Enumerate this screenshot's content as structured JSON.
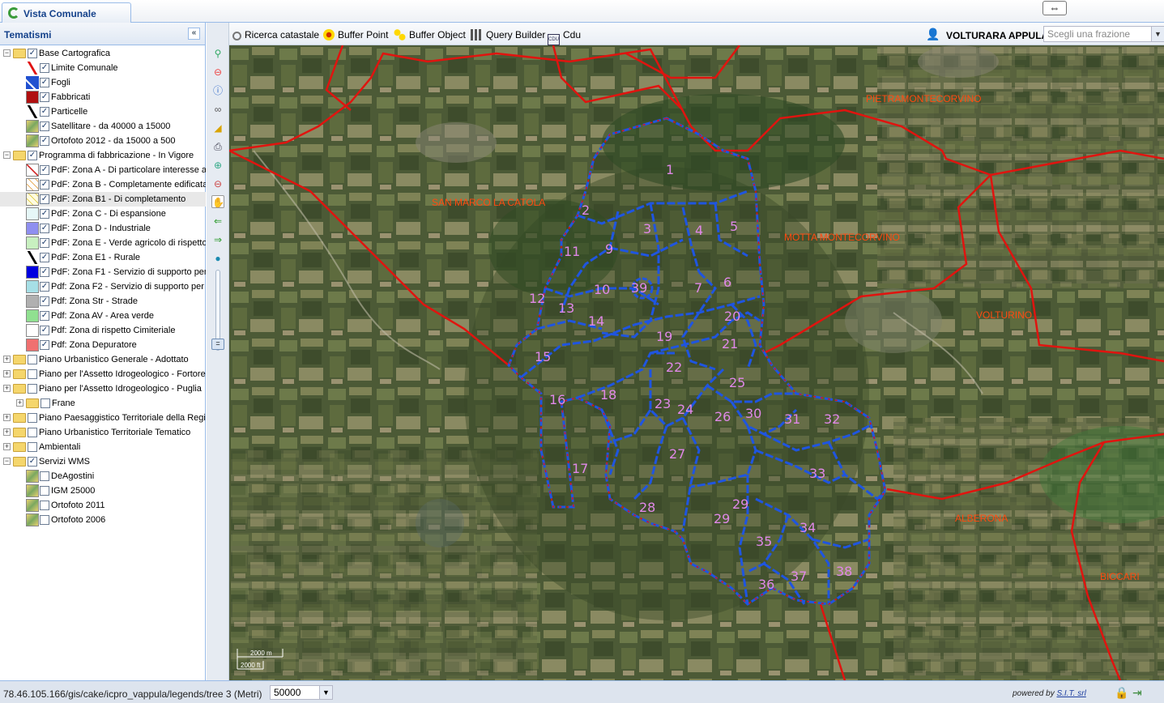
{
  "app": {
    "tab_title": "Vista Comunale"
  },
  "left_panel": {
    "title": "Tematismi",
    "collapse_glyph": "«",
    "items": [
      {
        "label": "Base Cartografica",
        "level": 0,
        "expanded": true,
        "checked": true
      },
      {
        "label": "Limite Comunale",
        "level": 1,
        "checked": true,
        "swatch": "red-line"
      },
      {
        "label": "Fogli",
        "level": 1,
        "checked": true,
        "swatch": "blue-poly"
      },
      {
        "label": "Fabbricati",
        "level": 1,
        "checked": true,
        "swatch": "#b01010"
      },
      {
        "label": "Particelle",
        "level": 1,
        "checked": true,
        "swatch": "black-line"
      },
      {
        "label": "Satellitare - da 40000 a 15000",
        "level": 1,
        "checked": true,
        "swatch": "raster"
      },
      {
        "label": "Ortofoto 2012 - da 15000 a 500",
        "level": 1,
        "checked": true,
        "swatch": "raster"
      },
      {
        "label": "Programma di fabbricazione - In Vigore",
        "level": 0,
        "expanded": true,
        "checked": true
      },
      {
        "label": "PdF: Zona A - Di particolare interesse a",
        "level": 1,
        "checked": true,
        "swatch": "hatch-red"
      },
      {
        "label": "PdF: Zona B - Completamente edificata",
        "level": 1,
        "checked": true,
        "swatch": "hatch-orange"
      },
      {
        "label": "PdF: Zona B1 - Di completamento",
        "level": 1,
        "checked": true,
        "swatch": "hatch-yellow",
        "selected": true
      },
      {
        "label": "PdF: Zona C - Di espansione",
        "level": 1,
        "checked": true,
        "swatch": "#e6f7f7"
      },
      {
        "label": "PdF: Zona D - Industriale",
        "level": 1,
        "checked": true,
        "swatch": "#8f8ff0"
      },
      {
        "label": "PdF: Zona E - Verde agricolo di rispetto",
        "level": 1,
        "checked": true,
        "swatch": "#c8f0c0"
      },
      {
        "label": "PdF: Zona E1 - Rurale",
        "level": 1,
        "checked": true,
        "swatch": "black-line"
      },
      {
        "label": "PdF: Zona F1 - Servizio di supporto per",
        "level": 1,
        "checked": true,
        "swatch": "#0000e0"
      },
      {
        "label": "Pdf: Zona F2 - Servizio di supporto per",
        "level": 1,
        "checked": true,
        "swatch": "#a6dfe6"
      },
      {
        "label": "Pdf: Zona Str - Strade",
        "level": 1,
        "checked": true,
        "swatch": "#b0b0b0"
      },
      {
        "label": "Pdf: Zona AV - Area verde",
        "level": 1,
        "checked": true,
        "swatch": "#90e090"
      },
      {
        "label": "Pdf: Zona di rispetto Cimiteriale",
        "level": 1,
        "checked": true,
        "swatch": "#ffffff"
      },
      {
        "label": "Pdf: Zona Depuratore",
        "level": 1,
        "checked": true,
        "swatch": "#f07070"
      },
      {
        "label": "Piano Urbanistico Generale - Adottato",
        "level": 0,
        "expanded": false,
        "checked": false
      },
      {
        "label": "Piano per l'Assetto Idrogeologico - Fortore",
        "level": 0,
        "expanded": false,
        "checked": false
      },
      {
        "label": "Piano per l'Assetto Idrogeologico - Puglia",
        "level": 0,
        "expanded": false,
        "checked": false
      },
      {
        "label": "Frane",
        "level": 0.5,
        "expanded": false,
        "checked": false
      },
      {
        "label": "Piano Paesaggistico Territoriale della Regio",
        "level": 0,
        "expanded": false,
        "checked": false
      },
      {
        "label": "Piano Urbanistico Territoriale Tematico",
        "level": 0,
        "expanded": false,
        "checked": false
      },
      {
        "label": "Ambientali",
        "level": 0,
        "expanded": false,
        "checked": false
      },
      {
        "label": "Servizi WMS",
        "level": 0,
        "expanded": true,
        "checked": true
      },
      {
        "label": "DeAgostini",
        "level": 1,
        "checked": false,
        "swatch": "raster"
      },
      {
        "label": "IGM 25000",
        "level": 1,
        "checked": false,
        "swatch": "raster"
      },
      {
        "label": "Ortofoto 2011",
        "level": 1,
        "checked": false,
        "swatch": "raster"
      },
      {
        "label": "Ortofoto 2006",
        "level": 1,
        "checked": false,
        "swatch": "raster"
      }
    ]
  },
  "toolbar": {
    "ricerca": "Ricerca catastale",
    "buffer_point": "Buffer Point",
    "buffer_object": "Buffer Object",
    "query_builder": "Query Builder",
    "cdu": "Cdu",
    "town": "VOLTURARA APPULA",
    "frazione_placeholder": "Scegli una frazione"
  },
  "map": {
    "municipalities": [
      "PIETRAMONTECORVINO",
      "SAN MARCO LA CATOLA",
      "MOTTA MONTECORVINO",
      "VOLTURINO",
      "ALBERONA",
      "BICCARI"
    ],
    "sheet_numbers": [
      "1",
      "2",
      "3",
      "4",
      "5",
      "6",
      "7",
      "9",
      "10",
      "11",
      "12",
      "13",
      "14",
      "15",
      "16",
      "17",
      "18",
      "19",
      "20",
      "21",
      "22",
      "23",
      "24",
      "25",
      "26",
      "27",
      "28",
      "29",
      "29",
      "30",
      "31",
      "32",
      "33",
      "34",
      "35",
      "36",
      "37",
      "38",
      "39"
    ],
    "scalebar_top": "2000 m",
    "scalebar_bottom": "2000 ft"
  },
  "status": {
    "url": "78.46.105.166/gis/cake/icpro_vappula/legends/tree",
    "units": "3 (Metri)",
    "scale": "50000",
    "powered_prefix": "powered by",
    "powered_brand": "S.I.T. srl"
  }
}
